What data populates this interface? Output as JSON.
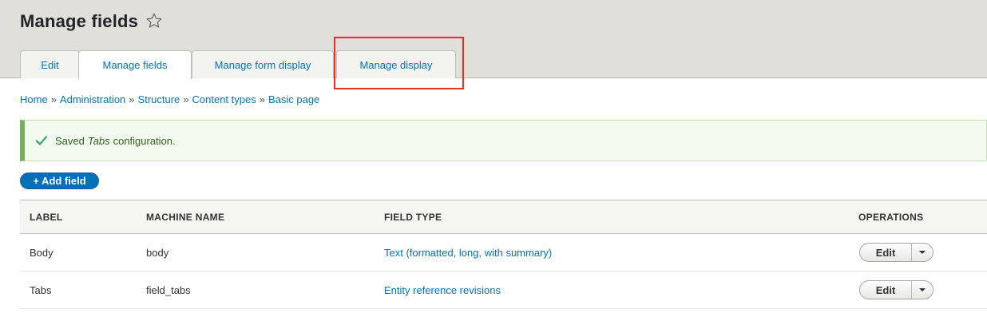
{
  "page": {
    "title": "Manage fields"
  },
  "tabs": [
    {
      "label": "Edit"
    },
    {
      "label": "Manage fields"
    },
    {
      "label": "Manage form display"
    },
    {
      "label": "Manage display"
    }
  ],
  "breadcrumb": [
    {
      "label": "Home"
    },
    {
      "label": "Administration"
    },
    {
      "label": "Structure"
    },
    {
      "label": "Content types"
    },
    {
      "label": "Basic page"
    }
  ],
  "breadcrumb_separator": "»",
  "message": {
    "prefix": "Saved",
    "entity": "Tabs",
    "suffix": "configuration."
  },
  "add_field": {
    "label": "+ Add field"
  },
  "table": {
    "headers": [
      "LABEL",
      "MACHINE NAME",
      "FIELD TYPE",
      "OPERATIONS"
    ],
    "rows": [
      {
        "label": "Body",
        "machine_name": "body",
        "field_type": "Text (formatted, long, with summary)",
        "operation": "Edit"
      },
      {
        "label": "Tabs",
        "machine_name": "field_tabs",
        "field_type": "Entity reference revisions",
        "operation": "Edit"
      }
    ]
  },
  "icons": {
    "favorite": "star-outline-icon",
    "status": "check-icon",
    "dropdown": "caret-down-icon"
  },
  "colors": {
    "link": "#0074bd",
    "primary_button": "#0071b8",
    "success_border": "#77b259",
    "highlight": "#e8301c"
  }
}
